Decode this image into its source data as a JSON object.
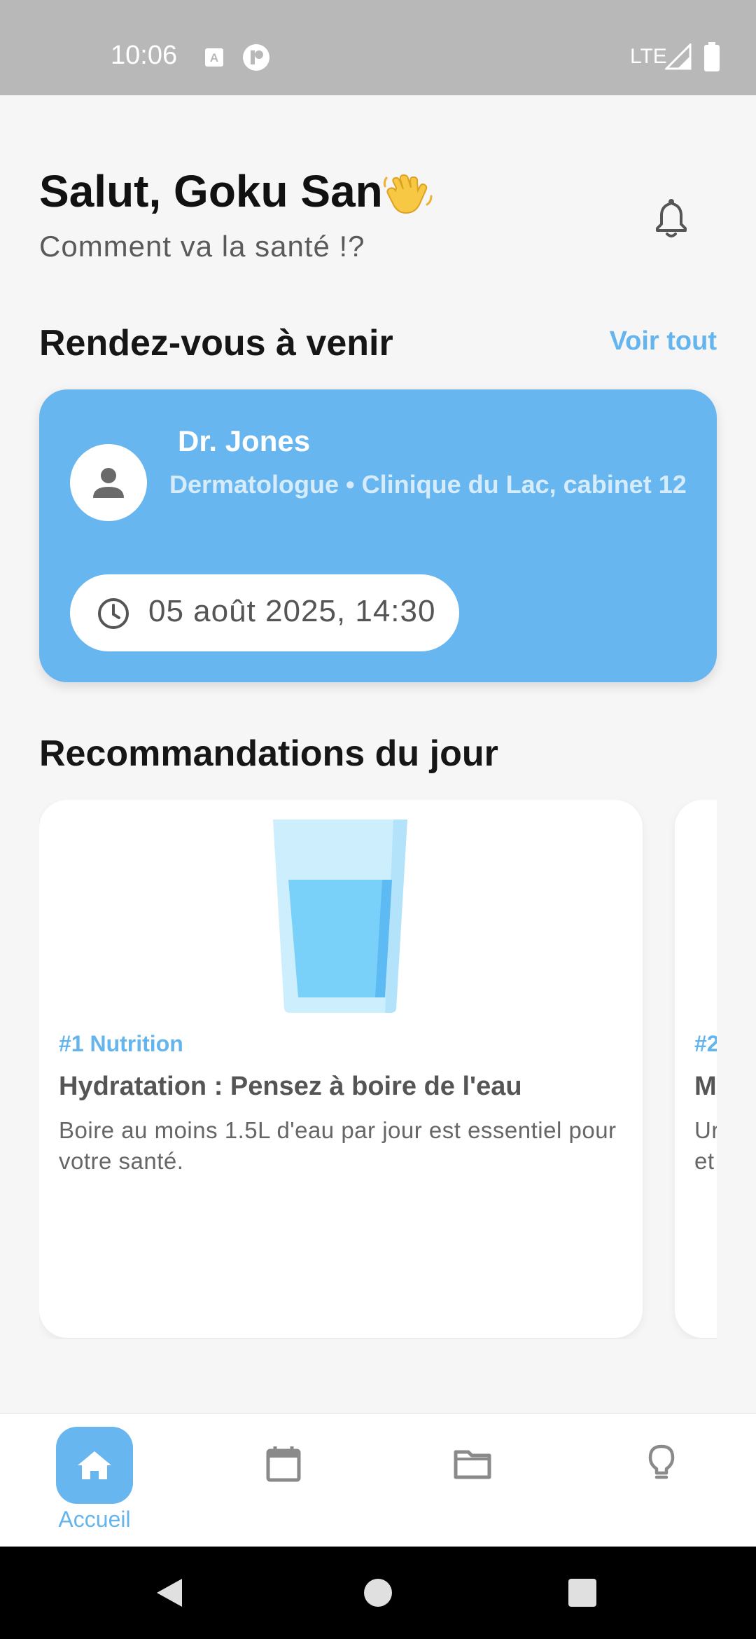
{
  "status_bar": {
    "time": "10:06",
    "network": "LTE"
  },
  "header": {
    "greeting": "Salut, Goku San",
    "subtitle": "Comment va la santé !?"
  },
  "appointments": {
    "title": "Rendez-vous à venir",
    "see_all": "Voir tout",
    "card": {
      "doctor": "Dr. Jones",
      "details": "Dermatologue • Clinique du Lac, cabinet 12",
      "datetime": "05 août 2025, 14:30"
    }
  },
  "recommendations": {
    "title": "Recommandations du jour",
    "items": [
      {
        "tag": "#1 Nutrition",
        "title": "Hydratation : Pensez à boire de l'eau",
        "description": "Boire au moins 1.5L d'eau par jour est essentiel pour votre santé."
      },
      {
        "tag": "#2",
        "title": "M",
        "description": "Ur et"
      }
    ]
  },
  "bottom_nav": {
    "items": [
      {
        "label": "Accueil",
        "icon": "home-icon",
        "active": true
      },
      {
        "label": "",
        "icon": "calendar-icon",
        "active": false
      },
      {
        "label": "",
        "icon": "folder-icon",
        "active": false
      },
      {
        "label": "",
        "icon": "lightbulb-icon",
        "active": false
      }
    ]
  },
  "colors": {
    "accent": "#67b6ef",
    "background": "#f6f6f6",
    "text": "#111111"
  }
}
